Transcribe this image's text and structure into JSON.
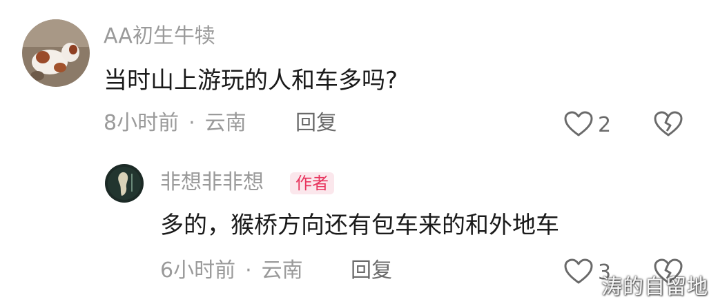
{
  "comments": [
    {
      "username": "AA初生牛犊",
      "content": "当时山上游玩的人和车多吗?",
      "time": "8小时前",
      "location": "云南",
      "reply_label": "回复",
      "likes": "2"
    }
  ],
  "reply": {
    "username": "非想非非想",
    "badge": "作者",
    "content": "多的，猴桥方向还有包车来的和外地车",
    "time": "6小时前",
    "location": "云南",
    "reply_label": "回复",
    "likes": "3"
  },
  "separator": "·",
  "icons": {
    "like": "heart-outline-icon",
    "dislike": "broken-heart-icon"
  },
  "colors": {
    "badge_text": "#e8365f",
    "badge_bg": "#fbe7ec",
    "meta_text": "#9a9a9a"
  },
  "watermark": "涛的自留地"
}
